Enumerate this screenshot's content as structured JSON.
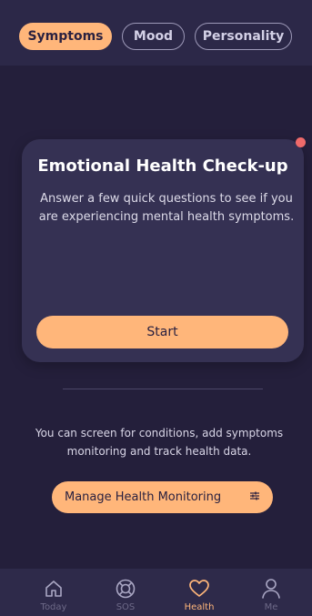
{
  "tabs": [
    {
      "label": "Symptoms"
    },
    {
      "label": "Mood"
    },
    {
      "label": "Personality"
    }
  ],
  "active_tab": "Symptoms",
  "card": {
    "title": "Emotional Health Check-up",
    "description": "Answer a few quick questions to see if you are experiencing mental health symptoms.",
    "start_label": "Start"
  },
  "info_text": "You can screen for conditions, add symptoms monitoring and track health data.",
  "manage_button_label": "Manage Health Monitoring",
  "nav": [
    {
      "label": "Today",
      "icon": "home-icon"
    },
    {
      "label": "SOS",
      "icon": "lifebuoy-icon"
    },
    {
      "label": "Health",
      "icon": "heart-icon"
    },
    {
      "label": "Me",
      "icon": "person-icon"
    }
  ],
  "active_nav": "Health",
  "colors": {
    "background": "#241f3b",
    "accent": "#ffb67a",
    "card": "#353153",
    "notification_dot": "#ef6a6a"
  }
}
